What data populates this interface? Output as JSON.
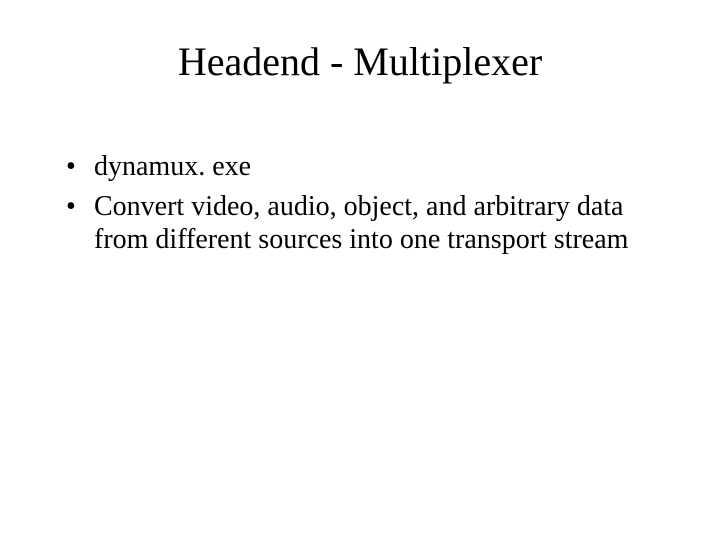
{
  "slide": {
    "title": "Headend - Multiplexer",
    "bullets": [
      "dynamux. exe",
      "Convert video, audio, object, and arbitrary data from different sources into one transport stream"
    ]
  }
}
